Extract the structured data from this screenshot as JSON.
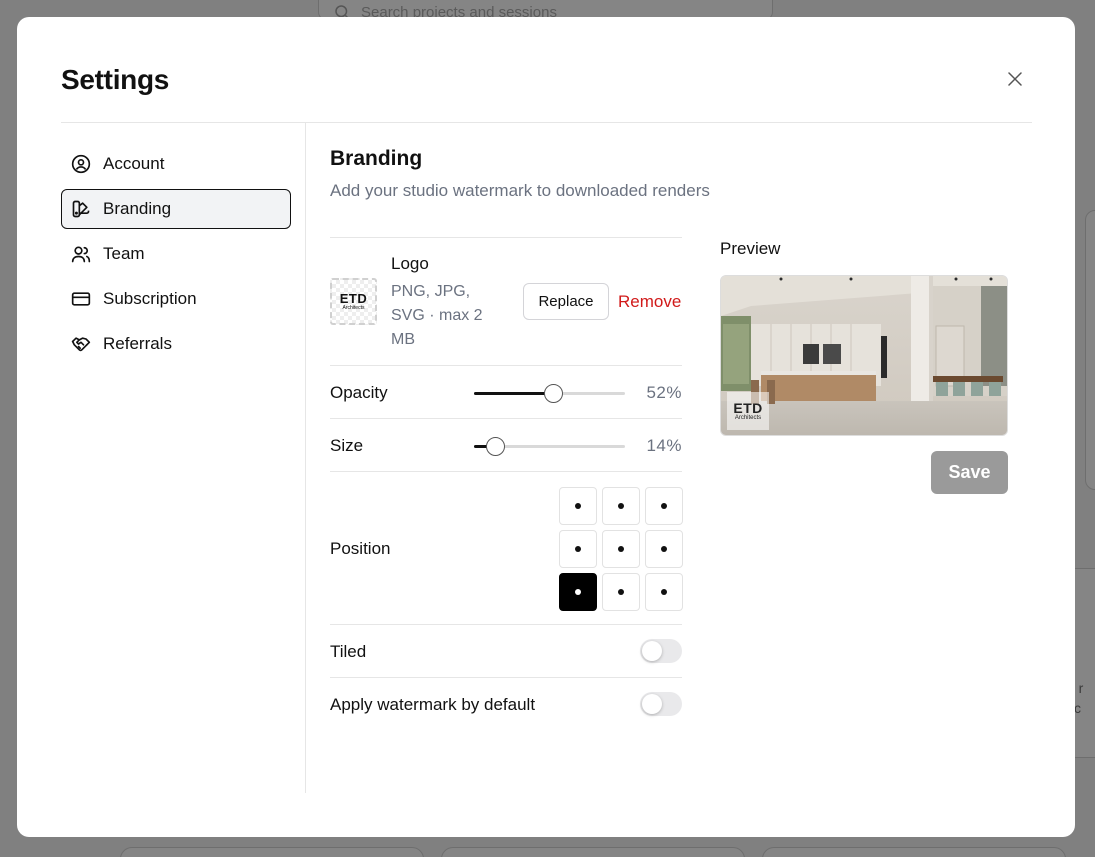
{
  "background": {
    "search_placeholder": "Search projects and sessions",
    "right_text_line1": "ny r",
    "right_text_line2": "w c"
  },
  "modal": {
    "title": "Settings",
    "close_icon": "x-icon"
  },
  "sidebar": {
    "items": [
      {
        "label": "Account",
        "icon": "user-circle-icon",
        "active": false
      },
      {
        "label": "Branding",
        "icon": "palette-icon",
        "active": true
      },
      {
        "label": "Team",
        "icon": "users-icon",
        "active": false
      },
      {
        "label": "Subscription",
        "icon": "credit-card-icon",
        "active": false
      },
      {
        "label": "Referrals",
        "icon": "handshake-icon",
        "active": false
      }
    ]
  },
  "branding": {
    "title": "Branding",
    "subtitle": "Add your studio watermark to downloaded renders",
    "logo": {
      "label": "Logo",
      "meta": "PNG, JPG, SVG · max 2 MB",
      "thumb_text": "ETD",
      "thumb_subtext": "Architects",
      "replace_label": "Replace",
      "remove_label": "Remove"
    },
    "opacity": {
      "label": "Opacity",
      "value": 52,
      "display": "52%"
    },
    "size": {
      "label": "Size",
      "value": 14,
      "display": "14%"
    },
    "position": {
      "label": "Position",
      "options": [
        "top-left",
        "top-center",
        "top-right",
        "middle-left",
        "center",
        "middle-right",
        "bottom-left",
        "bottom-center",
        "bottom-right"
      ],
      "selected": "bottom-left"
    },
    "tiled": {
      "label": "Tiled",
      "on": false
    },
    "apply_default": {
      "label": "Apply watermark by default",
      "on": false
    },
    "preview": {
      "label": "Preview",
      "watermark_text": "ETD",
      "watermark_subtext": "Architects"
    },
    "save_label": "Save"
  },
  "colors": {
    "accent": "#000000",
    "danger": "#d11a1a",
    "save_disabled": "#9a9a9a"
  }
}
